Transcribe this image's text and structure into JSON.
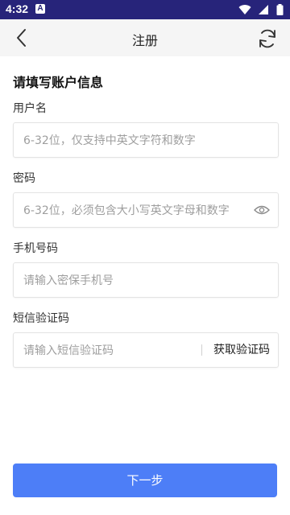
{
  "status_bar": {
    "time": "4:32",
    "notification_badge": "A"
  },
  "top_bar": {
    "title": "注册",
    "back_icon": "chevron-left-icon",
    "refresh_icon": "refresh-icon"
  },
  "form": {
    "section_title": "请填写账户信息",
    "username": {
      "label": "用户名",
      "placeholder": "6-32位，仅支持中英文字符和数字",
      "value": ""
    },
    "password": {
      "label": "密码",
      "placeholder": "6-32位，必须包含大小写英文字母和数字",
      "value": "",
      "toggle_icon": "eye-icon"
    },
    "phone": {
      "label": "手机号码",
      "placeholder": "请输入密保手机号",
      "value": ""
    },
    "sms_code": {
      "label": "短信验证码",
      "placeholder": "请输入短信验证码",
      "value": "",
      "get_code_label": "获取验证码"
    }
  },
  "next_button": {
    "label": "下一步",
    "color": "#4d7ef7"
  },
  "colors": {
    "status_bar": "#27247a",
    "top_bar": "#f5f5f5",
    "accent": "#4d7ef7"
  }
}
